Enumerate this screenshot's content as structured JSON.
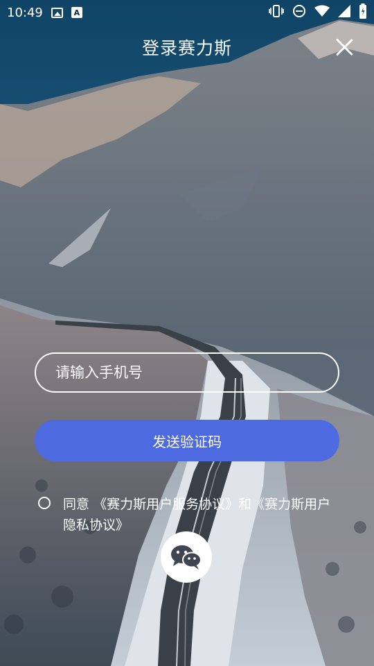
{
  "status_bar": {
    "time": "10:49",
    "icons_left": [
      "image-icon",
      "a-notification-icon"
    ],
    "icons_right": [
      "vibrate-icon",
      "dnd-icon",
      "wifi-icon",
      "signal-icon",
      "battery-icon"
    ]
  },
  "header": {
    "title": "登录赛力斯",
    "close_icon": "close-icon"
  },
  "form": {
    "phone_placeholder": "请输入手机号",
    "phone_value": "",
    "send_label": "发送验证码"
  },
  "agreement": {
    "prefix": "同意",
    "service_link": "《赛力斯用户服务协议》",
    "conjunction": "和",
    "privacy_link": "《赛力斯用户隐私协议》"
  },
  "wechat": {
    "icon": "wechat-icon"
  },
  "colors": {
    "primary": "#4e6ae0",
    "text": "#ffffff"
  }
}
